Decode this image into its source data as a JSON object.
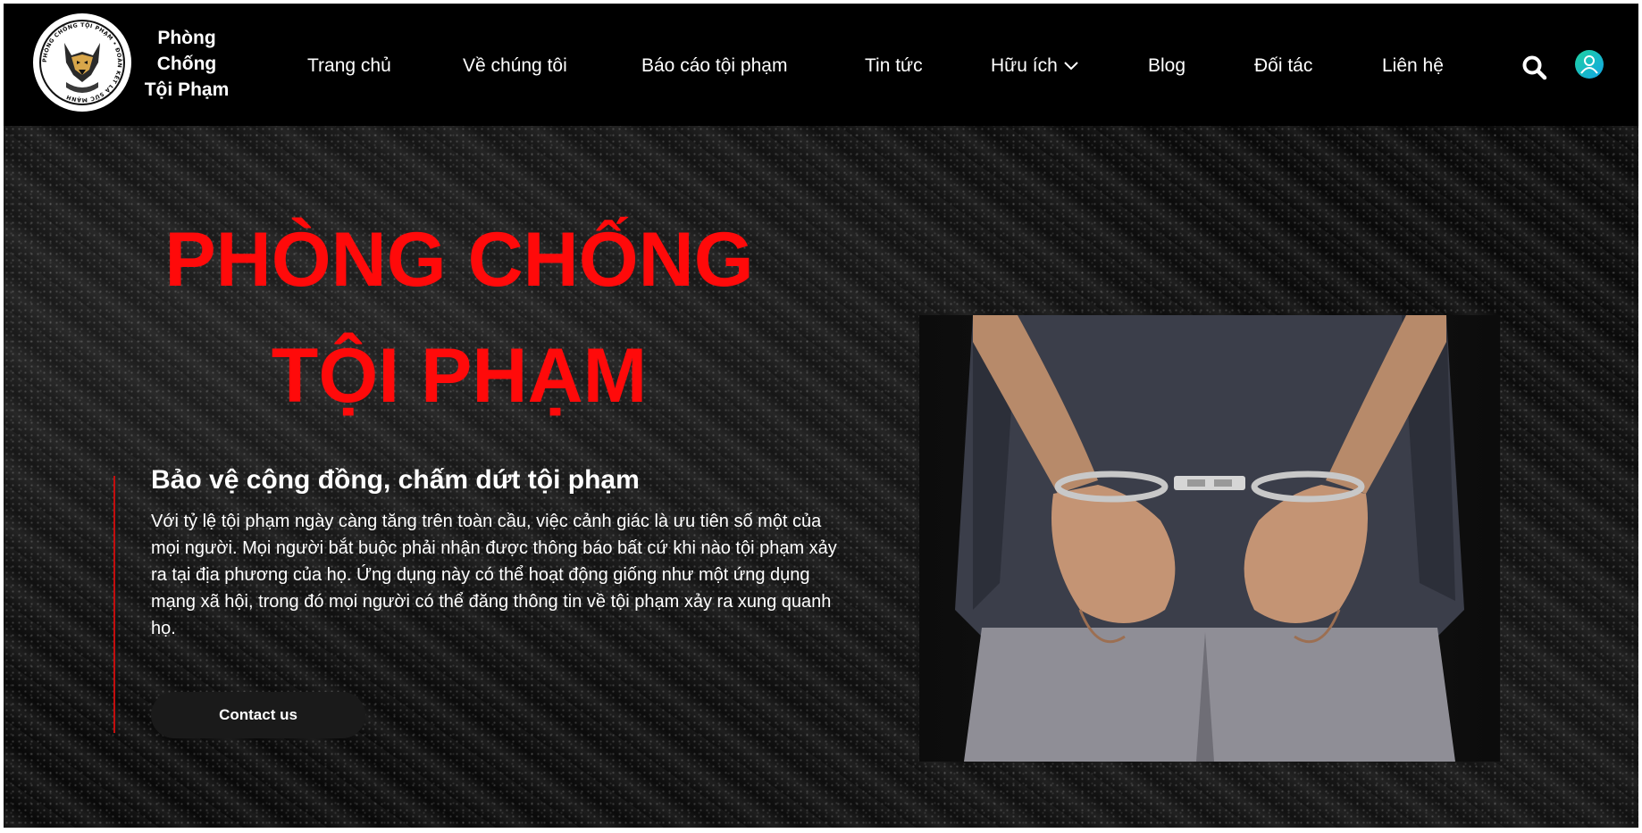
{
  "brand": {
    "name_lines": [
      "Phòng",
      "Chống",
      "Tội Phạm"
    ],
    "logo_ring_text": "PHÒNG CHỐNG TỘI PHẠM • ĐOÀN KẾT LÀ SỨC MẠNH"
  },
  "nav": {
    "items": [
      {
        "label": "Trang chủ"
      },
      {
        "label": "Về chúng tôi"
      },
      {
        "label": "Báo cáo tội phạm"
      },
      {
        "label": "Tin tức"
      },
      {
        "label": "Hữu ích",
        "has_dropdown": true
      },
      {
        "label": "Blog"
      },
      {
        "label": "Đối tác"
      },
      {
        "label": "Liên hệ"
      }
    ],
    "search_icon": "search-icon",
    "user_icon": "user-icon"
  },
  "hero": {
    "title_line1": "PHÒNG CHỐNG",
    "title_line2": "TỘI PHẠM",
    "subtitle": "Bảo vệ cộng đồng, chấm dứt tội phạm",
    "description": "Với tỷ lệ tội phạm ngày càng tăng trên toàn cầu, việc cảnh giác là ưu tiên số một của mọi người. Mọi người bắt buộc phải nhận được thông báo bất cứ khi nào tội phạm xảy ra tại địa phương của họ. Ứng dụng này có thể hoạt động giống như một ứng dụng mạng xã hội, trong đó mọi người có thể đăng thông tin về tội phạm xảy ra xung quanh họ.",
    "cta_label": "Contact us",
    "image": "handcuffed-hands-photo"
  },
  "colors": {
    "accent_red": "#ff0a0a",
    "header_bg": "#000000",
    "user_icon_gradient": [
      "#1fd3a0",
      "#11a4e6"
    ]
  }
}
